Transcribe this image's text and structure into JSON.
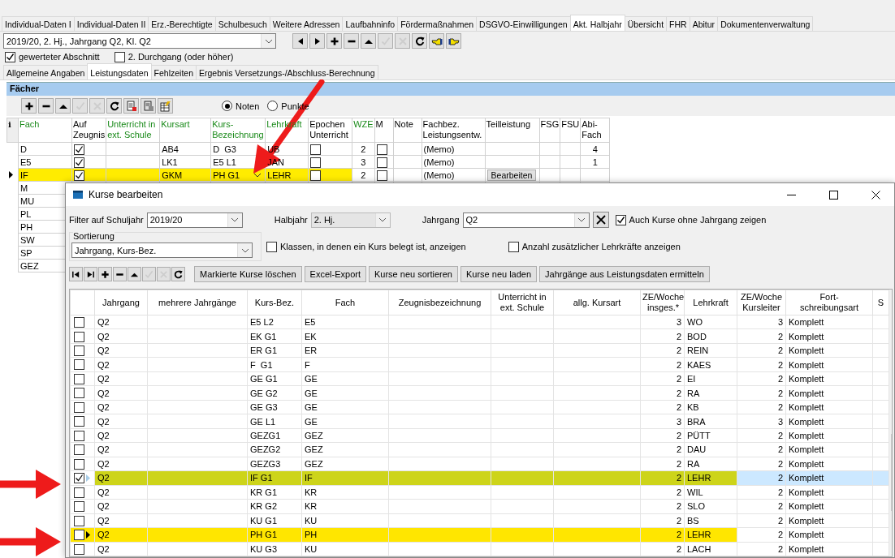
{
  "tabs": [
    {
      "label": "Individual-Daten I",
      "selected": false
    },
    {
      "label": "Individual-Daten II",
      "selected": false
    },
    {
      "label": "Erz.-Berechtigte",
      "selected": false
    },
    {
      "label": "Schulbesuch",
      "selected": false
    },
    {
      "label": "Weitere Adressen",
      "selected": false
    },
    {
      "label": "Laufbahninfo",
      "selected": false
    },
    {
      "label": "Fördermaßnahmen",
      "selected": false
    },
    {
      "label": "DSGVO-Einwilligungen",
      "selected": false
    },
    {
      "label": "Akt. Halbjahr",
      "selected": true
    },
    {
      "label": "Übersicht",
      "selected": false
    },
    {
      "label": "FHR",
      "selected": false
    },
    {
      "label": "Abitur",
      "selected": false
    },
    {
      "label": "Dokumentenverwaltung",
      "selected": false
    }
  ],
  "period_select": {
    "value": "2019/20, 2. Hj., Jahrgang Q2, Kl. Q2"
  },
  "period_toolbar": [
    {
      "kind": "prev",
      "disabled": false
    },
    {
      "kind": "next",
      "disabled": false
    },
    {
      "kind": "add",
      "disabled": false
    },
    {
      "kind": "remove",
      "disabled": false
    },
    {
      "kind": "up",
      "disabled": false
    },
    {
      "kind": "confirm",
      "disabled": true
    },
    {
      "kind": "cancel",
      "disabled": true
    },
    {
      "kind": "refresh",
      "disabled": false
    },
    {
      "kind": "point-left",
      "disabled": false
    },
    {
      "kind": "point-right",
      "disabled": false
    }
  ],
  "options": [
    {
      "label": "gewerteter Abschnitt",
      "checked": true
    },
    {
      "label": "2. Durchgang (oder höher)",
      "checked": false
    }
  ],
  "subtabs": [
    {
      "label": "Allgemeine Angaben",
      "selected": false
    },
    {
      "label": "Leistungsdaten",
      "selected": true
    },
    {
      "label": "Fehlzeiten",
      "selected": false
    },
    {
      "label": "Ergebnis Versetzungs-/Abschluss-Berechnung",
      "selected": false
    }
  ],
  "subjects": {
    "title": "Fächer",
    "toolbar": [
      {
        "kind": "add",
        "disabled": false
      },
      {
        "kind": "remove",
        "disabled": false
      },
      {
        "kind": "up",
        "disabled": false
      },
      {
        "kind": "confirm",
        "disabled": true
      },
      {
        "kind": "cancel",
        "disabled": true
      },
      {
        "kind": "refresh",
        "disabled": false
      },
      {
        "kind": "export",
        "disabled": false
      },
      {
        "kind": "import",
        "disabled": false
      },
      {
        "kind": "table-edit",
        "disabled": false
      }
    ],
    "grade_modes": [
      {
        "label": "Noten",
        "selected": true
      },
      {
        "label": "Punkte",
        "selected": false
      }
    ],
    "columns": [
      {
        "label": "i",
        "emphasized": false
      },
      {
        "label": "Fach",
        "emphasized": true
      },
      {
        "label": "Auf Zeugnis",
        "emphasized": false
      },
      {
        "label": "Unterricht in ext. Schule",
        "emphasized": true
      },
      {
        "label": "Kursart",
        "emphasized": true
      },
      {
        "label": "Kurs-Bezeichnung",
        "emphasized": true
      },
      {
        "label": "Lehrkraft",
        "emphasized": true
      },
      {
        "label": "Epochen Unterricht",
        "emphasized": false
      },
      {
        "label": "WZE",
        "emphasized": true
      },
      {
        "label": "M",
        "emphasized": false
      },
      {
        "label": "Note",
        "emphasized": false
      },
      {
        "label": "Fachbez. Leistungsentw.",
        "emphasized": false
      },
      {
        "label": "Teilleistung",
        "emphasized": false
      },
      {
        "label": "FSG",
        "emphasized": false
      },
      {
        "label": "FSU",
        "emphasized": false
      },
      {
        "label": "Abi-Fach",
        "emphasized": false
      }
    ],
    "rows": [
      {
        "fach": "D",
        "zeugnis": true,
        "kursart": "AB4",
        "kurs": "D  G3",
        "lehrkraft": "UB",
        "epochen": false,
        "wze": "2",
        "m": false,
        "fachbez": "(Memo)",
        "abi": "4",
        "selected": false
      },
      {
        "fach": "E5",
        "zeugnis": true,
        "kursart": "LK1",
        "kurs": "E5 L1",
        "lehrkraft": "JAN",
        "epochen": false,
        "wze": "3",
        "m": false,
        "fachbez": "(Memo)",
        "abi": "1",
        "selected": false
      },
      {
        "fach": "IF",
        "zeugnis": true,
        "kursart": "GKM",
        "kurs": "PH G1",
        "lehrkraft": "LEHR",
        "epochen": false,
        "wze": "2",
        "m": false,
        "fachbez": "(Memo)",
        "teil": "Bearbeiten",
        "selected": true
      },
      {
        "fach": "M",
        "selected": false
      },
      {
        "fach": "MU",
        "selected": false
      },
      {
        "fach": "PL",
        "selected": false
      },
      {
        "fach": "PH",
        "selected": false
      },
      {
        "fach": "SW",
        "selected": false
      },
      {
        "fach": "SP",
        "selected": false
      },
      {
        "fach": "GEZ",
        "selected": false
      }
    ]
  },
  "dialog": {
    "title": "Kurse bearbeiten",
    "filters": [
      {
        "label": "Filter auf Schuljahr",
        "value": "2019/20",
        "disabled": false,
        "clearable": false
      },
      {
        "label": "Halbjahr",
        "value": "2. Hj.",
        "disabled": true,
        "clearable": false
      },
      {
        "label": "Jahrgang",
        "value": "Q2",
        "disabled": false,
        "clearable": true
      }
    ],
    "show_without_grade": {
      "label": "Auch Kurse ohne Jahrgang zeigen",
      "checked": true
    },
    "sort": {
      "legend": "Sortierung",
      "value": "Jahrgang, Kurs-Bez."
    },
    "show_classes": {
      "label": "Klassen, in denen ein Kurs belegt ist, anzeigen",
      "checked": false
    },
    "show_teachers": {
      "label": "Anzahl zusätzlicher Lehrkräfte anzeigen",
      "checked": false
    },
    "toolbar": [
      {
        "kind": "first",
        "disabled": false
      },
      {
        "kind": "last",
        "disabled": false
      },
      {
        "kind": "add",
        "disabled": false
      },
      {
        "kind": "remove",
        "disabled": false
      },
      {
        "kind": "up",
        "disabled": false
      },
      {
        "kind": "confirm",
        "disabled": true
      },
      {
        "kind": "cancel",
        "disabled": true
      },
      {
        "kind": "refresh",
        "disabled": false
      }
    ],
    "actions": [
      "Markierte Kurse löschen",
      "Excel-Export",
      "Kurse neu sortieren",
      "Kurse neu laden",
      "Jahrgänge aus Leistungsdaten ermitteln"
    ],
    "columns": [
      "Jahrgang",
      "mehrere Jahrgänge",
      "Kurs-Bez.",
      "Fach",
      "Zeugnisbezeichnung",
      "Unterricht in ext. Schule",
      "allg. Kursart",
      "ZE/Woche insges.*",
      "Lehrkraft",
      "ZE/Woche Kursleiter",
      "Fort-schreibungsart",
      "S"
    ],
    "rows": [
      {
        "checked": false,
        "selected": false,
        "current": false,
        "jahrgang": "Q2",
        "kurs": "E5 L2",
        "fach": "E5",
        "ze": "3",
        "lehrkraft": "WO",
        "ze_leiter": "3",
        "art": "Komplett"
      },
      {
        "checked": false,
        "selected": false,
        "current": false,
        "jahrgang": "Q2",
        "kurs": "EK G1",
        "fach": "EK",
        "ze": "2",
        "lehrkraft": "BOD",
        "ze_leiter": "2",
        "art": "Komplett"
      },
      {
        "checked": false,
        "selected": false,
        "current": false,
        "jahrgang": "Q2",
        "kurs": "ER G1",
        "fach": "ER",
        "ze": "2",
        "lehrkraft": "REIN",
        "ze_leiter": "2",
        "art": "Komplett"
      },
      {
        "checked": false,
        "selected": false,
        "current": false,
        "jahrgang": "Q2",
        "kurs": "F  G1",
        "fach": "F",
        "ze": "2",
        "lehrkraft": "KAES",
        "ze_leiter": "2",
        "art": "Komplett"
      },
      {
        "checked": false,
        "selected": false,
        "current": false,
        "jahrgang": "Q2",
        "kurs": "GE G1",
        "fach": "GE",
        "ze": "2",
        "lehrkraft": "EI",
        "ze_leiter": "2",
        "art": "Komplett"
      },
      {
        "checked": false,
        "selected": false,
        "current": false,
        "jahrgang": "Q2",
        "kurs": "GE G2",
        "fach": "GE",
        "ze": "2",
        "lehrkraft": "RA",
        "ze_leiter": "2",
        "art": "Komplett"
      },
      {
        "checked": false,
        "selected": false,
        "current": false,
        "jahrgang": "Q2",
        "kurs": "GE G3",
        "fach": "GE",
        "ze": "2",
        "lehrkraft": "KB",
        "ze_leiter": "2",
        "art": "Komplett"
      },
      {
        "checked": false,
        "selected": false,
        "current": false,
        "jahrgang": "Q2",
        "kurs": "GE L1",
        "fach": "GE",
        "ze": "3",
        "lehrkraft": "BRA",
        "ze_leiter": "3",
        "art": "Komplett"
      },
      {
        "checked": false,
        "selected": false,
        "current": false,
        "jahrgang": "Q2",
        "kurs": "GEZG1",
        "fach": "GEZ",
        "ze": "2",
        "lehrkraft": "PÜTT",
        "ze_leiter": "2",
        "art": "Komplett"
      },
      {
        "checked": false,
        "selected": false,
        "current": false,
        "jahrgang": "Q2",
        "kurs": "GEZG2",
        "fach": "GEZ",
        "ze": "2",
        "lehrkraft": "DAU",
        "ze_leiter": "2",
        "art": "Komplett"
      },
      {
        "checked": false,
        "selected": false,
        "current": false,
        "jahrgang": "Q2",
        "kurs": "GEZG3",
        "fach": "GEZ",
        "ze": "2",
        "lehrkraft": "RA",
        "ze_leiter": "2",
        "art": "Komplett"
      },
      {
        "checked": true,
        "selected": true,
        "current": false,
        "color": "#cdd41a",
        "jahrgang": "Q2",
        "kurs": "IF G1",
        "fach": "IF",
        "ze": "2",
        "lehrkraft": "LEHR",
        "ze_leiter": "2",
        "art": "Komplett"
      },
      {
        "checked": false,
        "selected": false,
        "current": false,
        "jahrgang": "Q2",
        "kurs": "KR G1",
        "fach": "KR",
        "ze": "2",
        "lehrkraft": "WIL",
        "ze_leiter": "2",
        "art": "Komplett"
      },
      {
        "checked": false,
        "selected": false,
        "current": false,
        "jahrgang": "Q2",
        "kurs": "KR G2",
        "fach": "KR",
        "ze": "2",
        "lehrkraft": "SLO",
        "ze_leiter": "2",
        "art": "Komplett"
      },
      {
        "checked": false,
        "selected": false,
        "current": false,
        "jahrgang": "Q2",
        "kurs": "KU G1",
        "fach": "KU",
        "ze": "2",
        "lehrkraft": "BS",
        "ze_leiter": "2",
        "art": "Komplett"
      },
      {
        "checked": false,
        "selected": false,
        "current": true,
        "color": "#ffe600",
        "jahrgang": "Q2",
        "kurs": "PH G1",
        "fach": "PH",
        "ze": "2",
        "lehrkraft": "LEHR",
        "ze_leiter": "2",
        "art": "Komplett"
      },
      {
        "checked": false,
        "selected": false,
        "current": false,
        "jahrgang": "Q2",
        "kurs": "KU G3",
        "fach": "KU",
        "ze": "2",
        "lehrkraft": "LACH",
        "ze_leiter": "2",
        "art": "Komplett"
      }
    ]
  }
}
